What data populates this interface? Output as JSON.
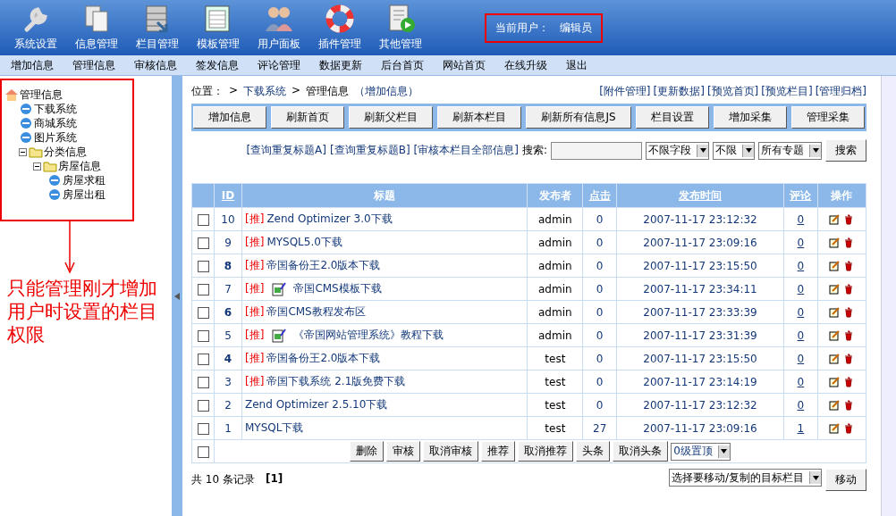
{
  "toolbar": {
    "items": [
      {
        "label": "系统设置"
      },
      {
        "label": "信息管理"
      },
      {
        "label": "栏目管理"
      },
      {
        "label": "模板管理"
      },
      {
        "label": "用户面板"
      },
      {
        "label": "插件管理"
      },
      {
        "label": "其他管理"
      }
    ],
    "current_user": {
      "label": "当前用户：",
      "value": "编辑员"
    }
  },
  "nav": [
    "增加信息",
    "管理信息",
    "审核信息",
    "签发信息",
    "评论管理",
    "数据更新",
    "后台首页",
    "网站首页",
    "在线升级",
    "退出"
  ],
  "tree": {
    "label": "管理信息",
    "kind": "root",
    "children": [
      {
        "label": "下载系统",
        "kind": "page"
      },
      {
        "label": "商城系统",
        "kind": "page"
      },
      {
        "label": "图片系统",
        "kind": "page"
      },
      {
        "label": "分类信息",
        "kind": "folder",
        "expanded": true,
        "children": [
          {
            "label": "房屋信息",
            "kind": "folder",
            "expanded": true,
            "children": [
              {
                "label": "房屋求租",
                "kind": "page"
              },
              {
                "label": "房屋出租",
                "kind": "page"
              }
            ]
          }
        ]
      }
    ]
  },
  "annotation": "只能管理刚才增加用户时设置的栏目权限",
  "breadcrumb": {
    "label": "位置：",
    "sep": ">",
    "links": [
      "下载系统"
    ],
    "current": "管理信息",
    "action": "（增加信息）"
  },
  "top_links": [
    "[附件管理]",
    "[更新数据]",
    "[预览首页]",
    "[预览栏目]",
    "[管理归档]"
  ],
  "action_buttons": [
    "增加信息",
    "刷新首页",
    "刷新父栏目",
    "刷新本栏目",
    "刷新所有信息JS",
    "栏目设置",
    "增加采集",
    "管理采集"
  ],
  "search": {
    "links": [
      "[查询重复标题A]",
      "[查询重复标题B]",
      "[审核本栏目全部信息]"
    ],
    "label": "搜索:",
    "selects": [
      "不限字段",
      "不限",
      "所有专题"
    ],
    "button": "搜索"
  },
  "table": {
    "columns": [
      {
        "label": "ID",
        "sortable": true
      },
      {
        "label": "标题",
        "sortable": false
      },
      {
        "label": "发布者",
        "sortable": false
      },
      {
        "label": "点击",
        "sortable": true
      },
      {
        "label": "发布时间",
        "sortable": true
      },
      {
        "label": "评论",
        "sortable": true
      },
      {
        "label": "操作",
        "sortable": false
      }
    ],
    "rows": [
      {
        "id": "10",
        "emphasized": false,
        "checked": false,
        "tag": "[推]",
        "has_picture": false,
        "title": "Zend Optimizer 3.0下载",
        "publisher": "admin",
        "clicks": "0",
        "time": "2007-11-17 23:12:32",
        "comments": "0"
      },
      {
        "id": "9",
        "emphasized": false,
        "checked": false,
        "tag": "[推]",
        "has_picture": false,
        "title": "MYSQL5.0下载",
        "publisher": "admin",
        "clicks": "0",
        "time": "2007-11-17 23:09:16",
        "comments": "0"
      },
      {
        "id": "8",
        "emphasized": true,
        "checked": false,
        "tag": "[推]",
        "has_picture": false,
        "title": "帝国备份王2.0版本下载",
        "publisher": "admin",
        "clicks": "0",
        "time": "2007-11-17 23:15:50",
        "comments": "0"
      },
      {
        "id": "7",
        "emphasized": false,
        "checked": false,
        "tag": "[推]",
        "has_picture": true,
        "title": "帝国CMS模板下载",
        "publisher": "admin",
        "clicks": "0",
        "time": "2007-11-17 23:34:11",
        "comments": "0"
      },
      {
        "id": "6",
        "emphasized": true,
        "checked": false,
        "tag": "[推]",
        "has_picture": false,
        "title": "帝国CMS教程发布区",
        "publisher": "admin",
        "clicks": "0",
        "time": "2007-11-17 23:33:39",
        "comments": "0"
      },
      {
        "id": "5",
        "emphasized": false,
        "checked": false,
        "tag": "[推]",
        "has_picture": true,
        "title": "《帝国网站管理系统》教程下载",
        "publisher": "admin",
        "clicks": "0",
        "time": "2007-11-17 23:31:39",
        "comments": "0"
      },
      {
        "id": "4",
        "emphasized": true,
        "checked": false,
        "tag": "[推]",
        "has_picture": false,
        "title": "帝国备份王2.0版本下载",
        "publisher": "test",
        "clicks": "0",
        "time": "2007-11-17 23:15:50",
        "comments": "0"
      },
      {
        "id": "3",
        "emphasized": false,
        "checked": false,
        "tag": "[推]",
        "has_picture": false,
        "title": "帝国下载系统 2.1版免费下载",
        "publisher": "test",
        "clicks": "0",
        "time": "2007-11-17 23:14:19",
        "comments": "0"
      },
      {
        "id": "2",
        "emphasized": false,
        "checked": false,
        "has_picture": false,
        "title": "Zend Optimizer 2.5.10下载",
        "publisher": "test",
        "clicks": "0",
        "time": "2007-11-17 23:12:32",
        "comments": "0"
      },
      {
        "id": "1",
        "emphasized": false,
        "checked": false,
        "has_picture": false,
        "title": "MYSQL下载",
        "publisher": "test",
        "clicks": "27",
        "time": "2007-11-17 23:09:16",
        "comments": "1"
      }
    ]
  },
  "bulk": {
    "checked": false,
    "buttons": [
      "删除",
      "审核",
      "取消审核",
      "推荐",
      "取消推荐",
      "头条",
      "取消头条"
    ],
    "select": "0级置顶"
  },
  "footer": {
    "count": "共 10 条记录",
    "pages": "[1]",
    "move_select": "选择要移动/复制的目标栏目",
    "move_button": "移动"
  }
}
